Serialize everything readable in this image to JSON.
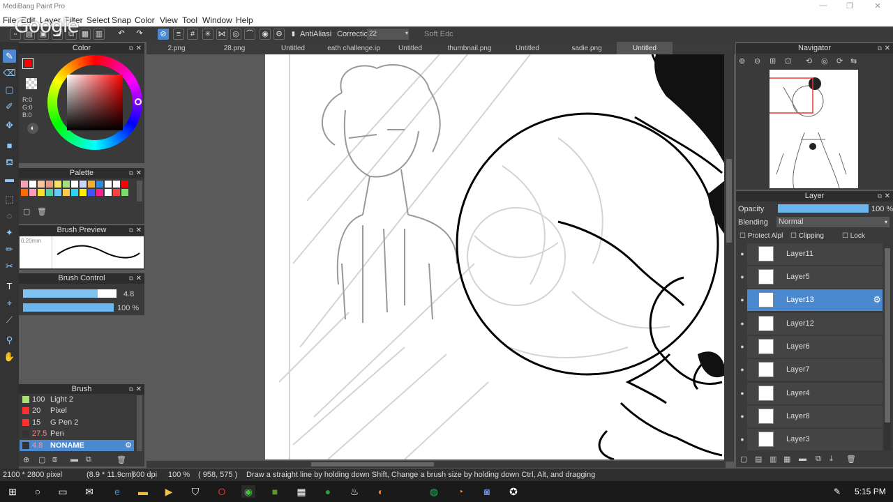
{
  "window": {
    "title": "MediBang Paint Pro",
    "minimize": "—",
    "maximize": "❐",
    "close": "✕"
  },
  "overlay_logo": "Google",
  "menu": [
    "File",
    "Edit",
    "Layer",
    "Filter",
    "Select",
    "Snap",
    "Color",
    "View",
    "Tool",
    "Window",
    "Help"
  ],
  "toolbar": {
    "antialias_label": "AntiAliasi",
    "correction_label": "Correctic",
    "correction_value": "22",
    "soft_edge_label": "Soft Edc"
  },
  "tabs": [
    "2.png",
    "28.png",
    "Untitled",
    "eath challenge.ip",
    "Untitled",
    "thumbnail.png",
    "Untitled",
    "sadie.png",
    "Untitled"
  ],
  "color_panel": {
    "title": "Color",
    "r": "R:0",
    "g": "G:0",
    "b": "B:0",
    "primary_color": "#ff0000"
  },
  "palette_panel": {
    "title": "Palette",
    "swatches": [
      "#f4a3b5",
      "#ffffff",
      "#f7c6a0",
      "#e89a84",
      "#f5e45f",
      "#a2e080",
      "#ffffff",
      "#c8d8ff",
      "#f3b030",
      "#2f8ae0",
      "#ffffff",
      "#ffffff",
      "#ff0000",
      "#ff6a00",
      "#ff9bbf",
      "#f8de2d",
      "#4fd0a8",
      "#66c8ff",
      "#ffc94c",
      "#2fd4f0",
      "#ffef00",
      "#3a55ff",
      "#ff1f8c",
      "#ffffff",
      "#ff4040",
      "#7adf6a"
    ]
  },
  "brush_preview_panel": {
    "title": "Brush Preview",
    "size_label": "0.20mm"
  },
  "brush_control_panel": {
    "title": "Brush Control",
    "size_value": "4.8",
    "opacity_value": "100 %",
    "size_fraction": 0.8,
    "opacity_fraction": 1.0
  },
  "brush_panel": {
    "title": "Brush",
    "items": [
      {
        "size": "100",
        "name": "Light 2",
        "color": "#a8e070"
      },
      {
        "size": "20",
        "name": "Pixel",
        "color": "#ff3030"
      },
      {
        "size": "15",
        "name": "G Pen 2",
        "color": "#ff3030"
      },
      {
        "size": "27.5",
        "name": "Pen",
        "color": "#333333"
      },
      {
        "size": "4.8",
        "name": "NONAME",
        "color": "#333333"
      }
    ],
    "selected_index": 4
  },
  "navigator_panel": {
    "title": "Navigator"
  },
  "layer_panel": {
    "title": "Layer",
    "opacity_label": "Opacity",
    "opacity_value": "100 %",
    "opacity_fraction": 1.0,
    "blending_label": "Blending",
    "blending_value": "Normal",
    "protect_alpha": "Protect Alpl",
    "clipping": "Clipping",
    "lock": "Lock",
    "layers": [
      "Layer11",
      "Layer5",
      "Layer13",
      "Layer12",
      "Layer6",
      "Layer7",
      "Layer4",
      "Layer8",
      "Layer3"
    ],
    "selected_index": 2
  },
  "status": {
    "dimensions": "2100 * 2800 pixel",
    "physical": "(8.9 * 11.9cm)",
    "dpi": "600 dpi",
    "zoom": "100 %",
    "cursor": "( 958, 575 )",
    "hint": "Draw a straight line by holding down Shift, Change a brush size by holding down Ctrl, Alt, and dragging"
  },
  "taskbar": {
    "time": "5:15 PM"
  }
}
